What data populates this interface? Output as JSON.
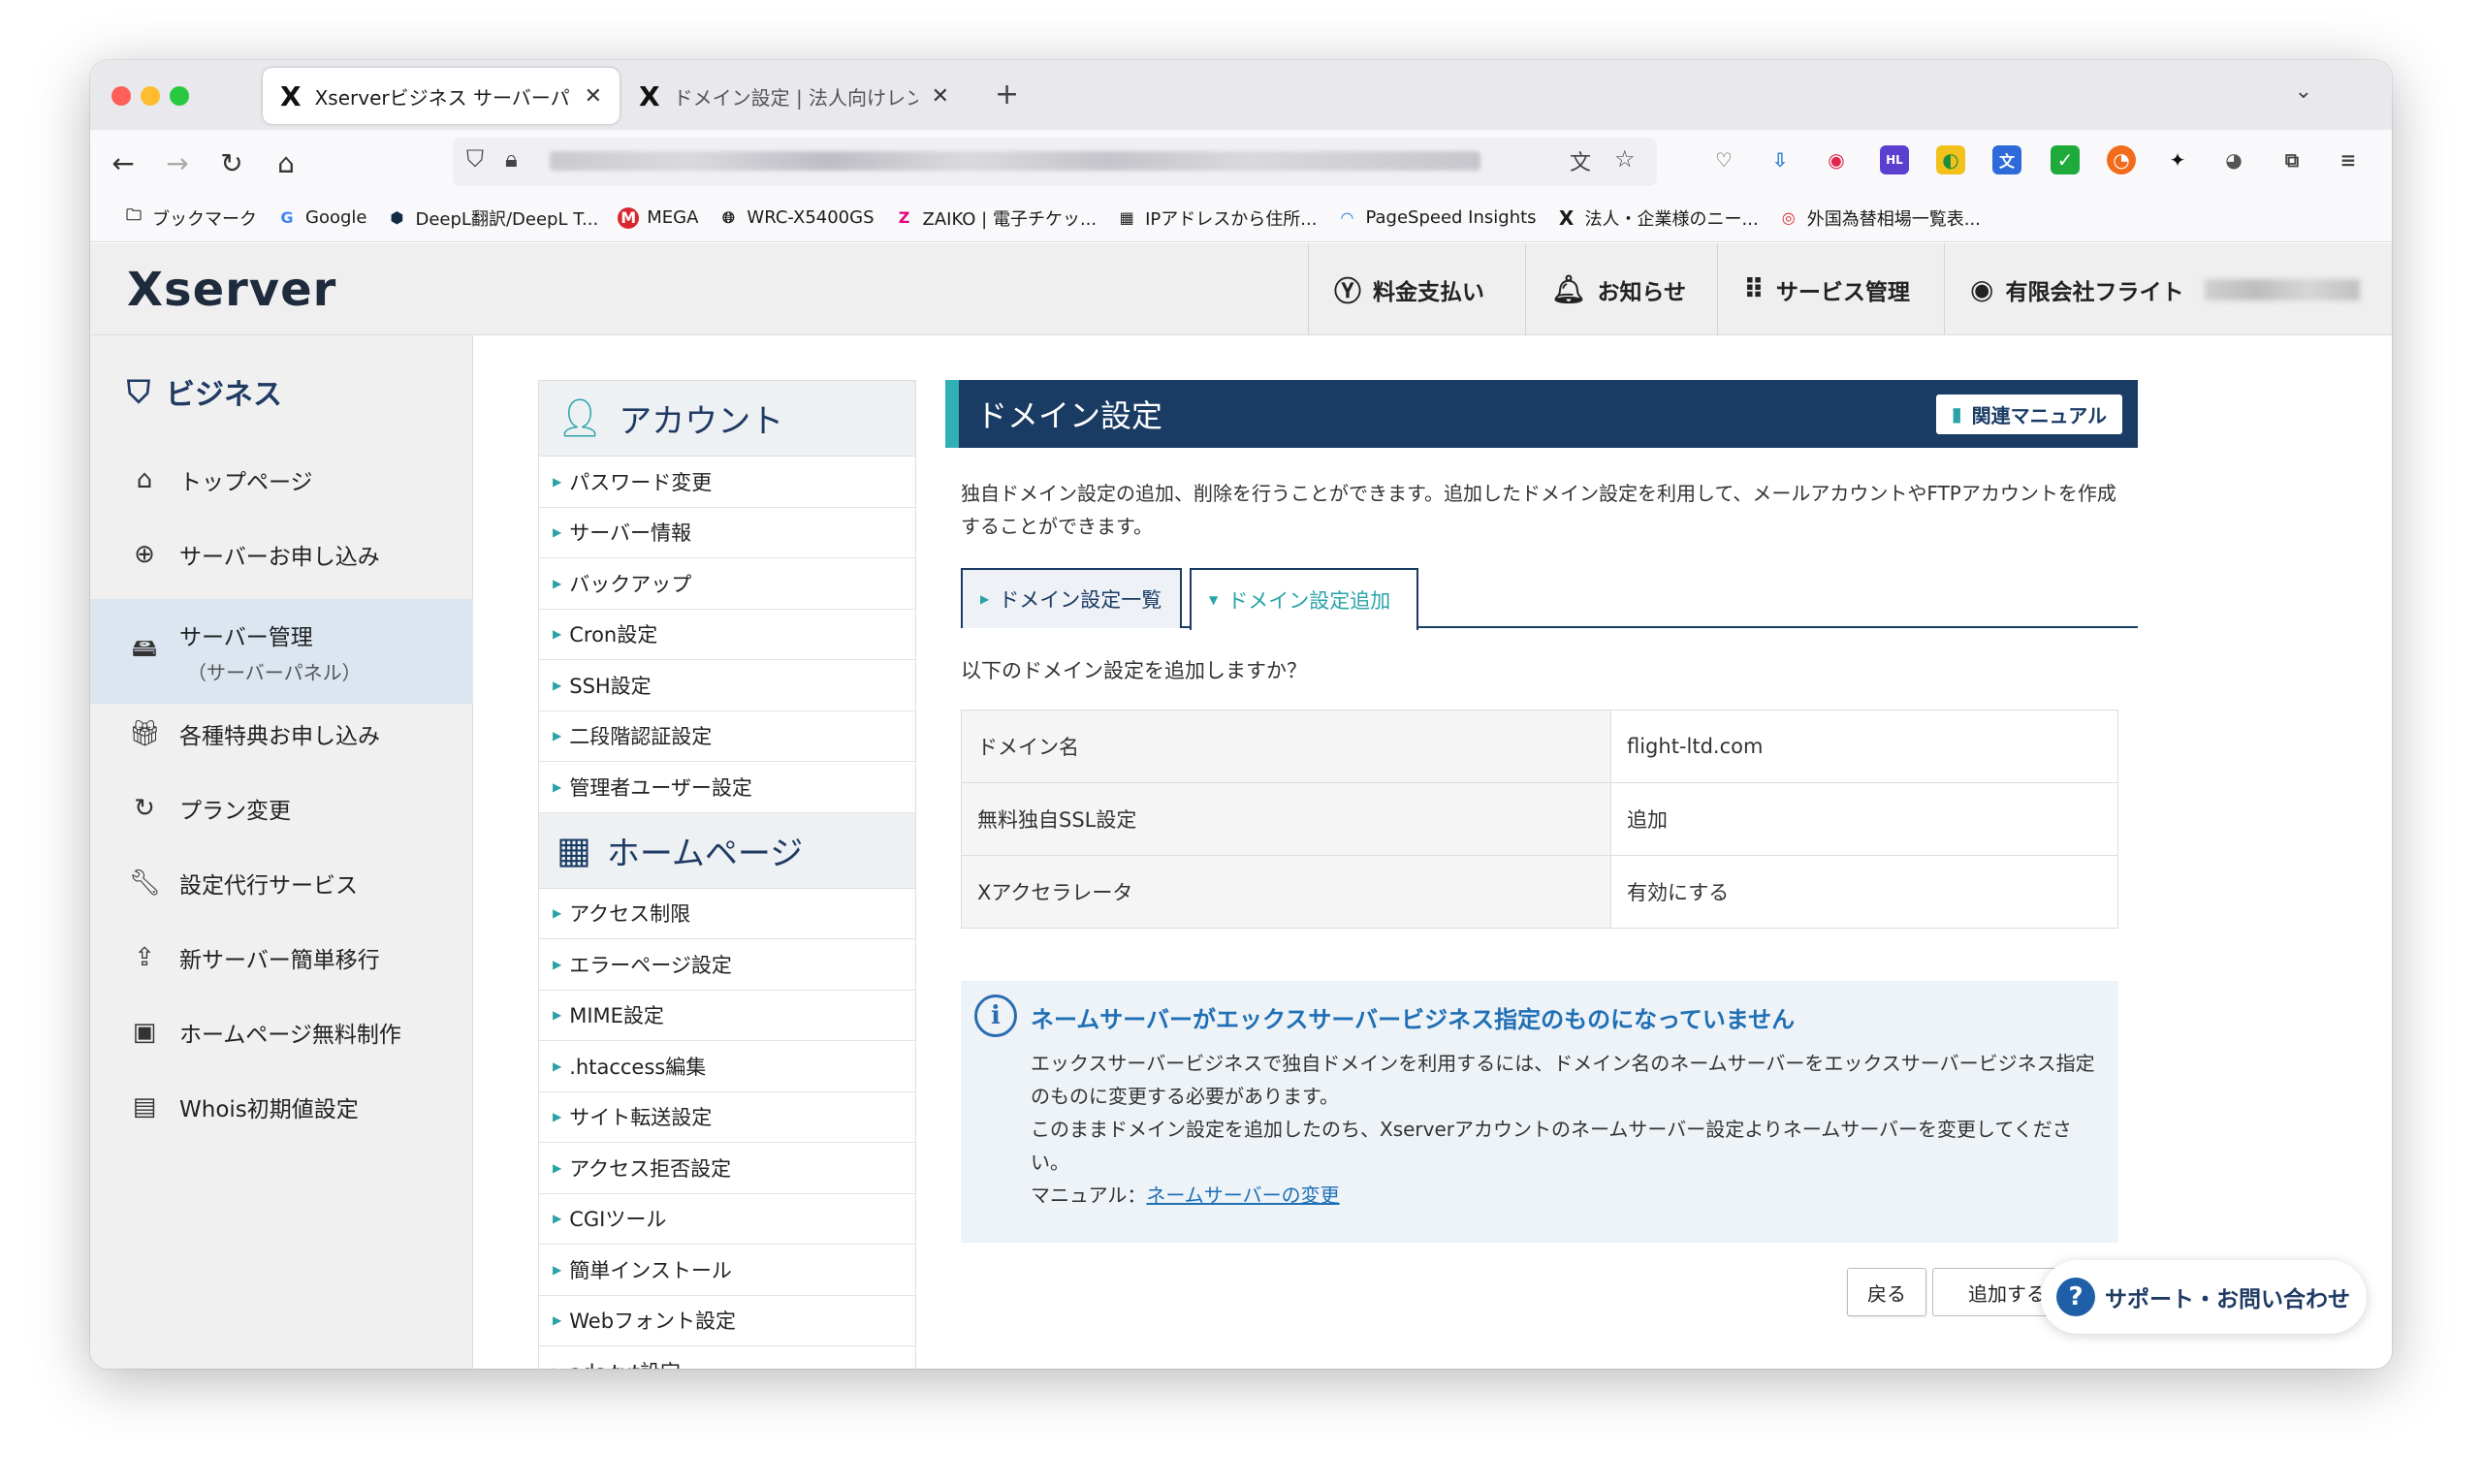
{
  "browser": {
    "tabs": [
      {
        "title": "Xserverビジネス サーバーパネル",
        "active": true
      },
      {
        "title": "ドメイン設定 | 法人向けレンタル",
        "active": false
      }
    ],
    "new_tab": "+",
    "tab_list": "⌄",
    "bookmarks": [
      {
        "label": "ブックマーク",
        "icon": "folder-icon"
      },
      {
        "label": "Google",
        "icon": "google-icon"
      },
      {
        "label": "DeepL翻訳/DeepL T...",
        "icon": "deepl-icon"
      },
      {
        "label": "MEGA",
        "icon": "mega-icon"
      },
      {
        "label": "WRC-X5400GS",
        "icon": "globe-icon"
      },
      {
        "label": "ZAIKO | 電子チケッ...",
        "icon": "zaiko-icon"
      },
      {
        "label": "IPアドレスから住所...",
        "icon": "ip-icon"
      },
      {
        "label": "PageSpeed Insights",
        "icon": "pagespeed-icon"
      },
      {
        "label": "法人・企業様のニー...",
        "icon": "xserver-icon"
      },
      {
        "label": "外国為替相場一覧表...",
        "icon": "mufg-icon"
      }
    ]
  },
  "header": {
    "logo": "Xserver",
    "payment": "料金支払い",
    "notices": "お知らせ",
    "services": "サービス管理",
    "account": "有限会社フライト"
  },
  "sidebar": {
    "title": "ビジネス",
    "items": [
      {
        "label": "トップページ",
        "icon": "home-icon"
      },
      {
        "label": "サーバーお申し込み",
        "icon": "plus-circle-icon"
      },
      {
        "label": "サーバー管理",
        "sub": "（サーバーパネル）",
        "icon": "server-icon",
        "active": true
      },
      {
        "label": "各種特典お申し込み",
        "icon": "gift-icon"
      },
      {
        "label": "プラン変更",
        "icon": "refresh-icon"
      },
      {
        "label": "設定代行サービス",
        "icon": "wrench-icon"
      },
      {
        "label": "新サーバー簡単移行",
        "icon": "upload-icon"
      },
      {
        "label": "ホームページ無料制作",
        "icon": "browser-icon"
      },
      {
        "label": "Whois初期値設定",
        "icon": "document-icon"
      }
    ]
  },
  "menu": {
    "account_head": "アカウント",
    "account_items": [
      "パスワード変更",
      "サーバー情報",
      "バックアップ",
      "Cron設定",
      "SSH設定",
      "二段階認証設定",
      "管理者ユーザー設定"
    ],
    "homepage_head": "ホームページ",
    "homepage_items": [
      "アクセス制限",
      "エラーページ設定",
      "MIME設定",
      ".htaccess編集",
      "サイト転送設定",
      "アクセス拒否設定",
      "CGIツール",
      "簡単インストール",
      "Webフォント設定",
      "ads.txt設定"
    ]
  },
  "main": {
    "title": "ドメイン設定",
    "manual": "関連マニュアル",
    "description": "独自ドメイン設定の追加、削除を行うことができます。追加したドメイン設定を利用して、メールアカウントやFTPアカウントを作成することができます。",
    "tab_list": "ドメイン設定一覧",
    "tab_add": "ドメイン設定追加",
    "confirm": "以下のドメイン設定を追加しますか？",
    "rows": [
      {
        "key": "ドメイン名",
        "value": "flight-ltd.com"
      },
      {
        "key": "無料独自SSL設定",
        "value": "追加"
      },
      {
        "key": "Xアクセラレータ",
        "value": "有効にする"
      }
    ],
    "notice": {
      "title": "ネームサーバーがエックスサーバービジネス指定のものになっていません",
      "line1": "エックスサーバービジネスで独自ドメインを利用するには、ドメイン名のネームサーバーをエックスサーバービジネス指定のものに変更する必要があります。",
      "line2": "このままドメイン設定を追加したのち、Xserverアカウントのネームサーバー設定よりネームサーバーを変更してください。",
      "manual_prefix": "マニュアル：",
      "manual_link": "ネームサーバーの変更"
    },
    "back_button": "戻る",
    "add_button": "追加する",
    "support": "サポート・お問い合わせ"
  }
}
